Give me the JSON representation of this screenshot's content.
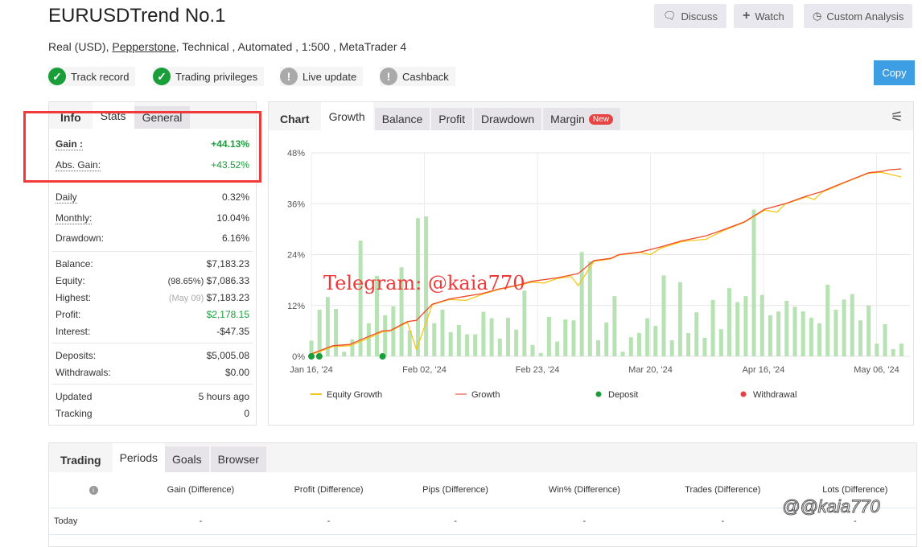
{
  "header": {
    "title": "EURUSDTrend No.1",
    "account_type": "Real (USD),",
    "broker": "Pepperstone",
    "details": ", Technical , Automated , 1:500 , MetaTrader 4",
    "buttons": {
      "discuss": "Discuss",
      "watch": "Watch",
      "custom_analysis": "Custom Analysis",
      "copy": "Copy"
    },
    "badges": [
      {
        "label": "Track record",
        "status": "verified"
      },
      {
        "label": "Trading privileges",
        "status": "verified"
      },
      {
        "label": "Live update",
        "status": "unverified"
      },
      {
        "label": "Cashback",
        "status": "unverified"
      }
    ]
  },
  "colors": {
    "green": "#1a9e3a",
    "accent": "#3d9ee4",
    "equity": "#f5c518",
    "growth": "#f04a2a",
    "bar": "#b7e2b3",
    "deposit": "#1a9e3a",
    "withdrawal": "#e84343"
  },
  "stats": {
    "tabs": [
      "Info",
      "Stats",
      "General"
    ],
    "gain": {
      "label": "Gain :",
      "value": "+44.13%"
    },
    "abs_gain": {
      "label": "Abs. Gain:",
      "value": "+43.52%"
    },
    "daily": {
      "label": "Daily",
      "value": "0.32%"
    },
    "monthly": {
      "label": "Monthly:",
      "value": "10.04%"
    },
    "drawdown": {
      "label": "Drawdown:",
      "value": "6.16%"
    },
    "balance": {
      "label": "Balance:",
      "value": "$7,183.23"
    },
    "equity": {
      "label": "Equity:",
      "note": "(98.65%)",
      "value": "$7,086.33"
    },
    "highest": {
      "label": "Highest:",
      "note": "(May 09)",
      "value": "$7,183.23"
    },
    "profit": {
      "label": "Profit:",
      "value": "$2,178.15"
    },
    "interest": {
      "label": "Interest:",
      "value": "-$47.35"
    },
    "deposits": {
      "label": "Deposits:",
      "value": "$5,005.08"
    },
    "withdrawals": {
      "label": "Withdrawals:",
      "value": "$0.00"
    },
    "updated": {
      "label": "Updated",
      "value": "5 hours ago"
    },
    "tracking": {
      "label": "Tracking",
      "value": "0"
    }
  },
  "chart_tabs": {
    "chart": "Chart",
    "growth": "Growth",
    "balance": "Balance",
    "profit": "Profit",
    "drawdown": "Drawdown",
    "margin": "Margin",
    "new_badge": "New"
  },
  "watermark": "Telegram: @kaia770",
  "watermark2": "@@kaia770",
  "chart_data": {
    "type": "line",
    "title": "Growth",
    "yticks": [
      "0%",
      "12%",
      "24%",
      "36%",
      "48%"
    ],
    "ylim": [
      0,
      48
    ],
    "xticks": [
      "Jan 16, '24",
      "Feb 02, '24",
      "Feb 23, '24",
      "Mar 20, '24",
      "Apr 16, '24",
      "May 06, '24"
    ],
    "legend": [
      "Equity Growth",
      "Growth",
      "Deposit",
      "Withdrawal"
    ],
    "legend_position": "bottom",
    "growth": [
      [
        0,
        0.6
      ],
      [
        0.19,
        2.5
      ],
      [
        0.34,
        2.8
      ],
      [
        0.48,
        4.4
      ],
      [
        0.63,
        6.0
      ],
      [
        0.7,
        6.1
      ],
      [
        0.85,
        8.2
      ],
      [
        0.93,
        8.5
      ],
      [
        1.07,
        12.3
      ],
      [
        1.22,
        13.5
      ],
      [
        1.37,
        14.2
      ],
      [
        1.51,
        14.8
      ],
      [
        1.66,
        15.9
      ],
      [
        1.81,
        16.7
      ],
      [
        1.95,
        17.7
      ],
      [
        2.17,
        18.5
      ],
      [
        2.36,
        19.5
      ],
      [
        2.5,
        22.6
      ],
      [
        2.65,
        23.1
      ],
      [
        2.72,
        24.0
      ],
      [
        2.91,
        24.6
      ],
      [
        3.09,
        25.8
      ],
      [
        3.27,
        27.2
      ],
      [
        3.49,
        28.4
      ],
      [
        3.64,
        29.8
      ],
      [
        3.83,
        31.7
      ],
      [
        4.01,
        34.7
      ],
      [
        4.19,
        36.0
      ],
      [
        4.38,
        37.8
      ],
      [
        4.52,
        38.9
      ],
      [
        4.6,
        39.8
      ],
      [
        4.74,
        41.3
      ],
      [
        4.93,
        43.3
      ],
      [
        5.04,
        43.6
      ],
      [
        5.11,
        44.0
      ],
      [
        5.22,
        44.2
      ]
    ],
    "equity_growth": [
      [
        0,
        0.4
      ],
      [
        0.19,
        2.3
      ],
      [
        0.34,
        2.5
      ],
      [
        0.48,
        4.0
      ],
      [
        0.63,
        5.8
      ],
      [
        0.7,
        6.0
      ],
      [
        0.85,
        8.0
      ],
      [
        0.93,
        1.6
      ],
      [
        1.07,
        12.2
      ],
      [
        1.22,
        13.4
      ],
      [
        1.37,
        13.2
      ],
      [
        1.51,
        14.6
      ],
      [
        1.66,
        15.8
      ],
      [
        1.81,
        16.6
      ],
      [
        1.95,
        17.5
      ],
      [
        2.06,
        17.3
      ],
      [
        2.17,
        18.3
      ],
      [
        2.3,
        18.8
      ],
      [
        2.36,
        16.7
      ],
      [
        2.5,
        22.4
      ],
      [
        2.65,
        23.0
      ],
      [
        2.72,
        23.9
      ],
      [
        2.91,
        24.5
      ],
      [
        3.0,
        24.0
      ],
      [
        3.09,
        25.5
      ],
      [
        3.27,
        27.0
      ],
      [
        3.35,
        27.3
      ],
      [
        3.49,
        27.6
      ],
      [
        3.64,
        29.6
      ],
      [
        3.83,
        31.6
      ],
      [
        4.01,
        34.5
      ],
      [
        4.12,
        34.0
      ],
      [
        4.19,
        35.9
      ],
      [
        4.38,
        37.6
      ],
      [
        4.45,
        37.0
      ],
      [
        4.52,
        38.8
      ],
      [
        4.6,
        39.6
      ],
      [
        4.74,
        41.2
      ],
      [
        4.93,
        43.2
      ],
      [
        5.04,
        43.4
      ],
      [
        5.11,
        43.0
      ],
      [
        5.22,
        42.3
      ]
    ],
    "daily_bars": [
      3.7,
      11,
      14,
      11.2,
      1.1,
      4,
      27.3,
      7.8,
      19,
      9.7,
      11.8,
      21,
      6.1,
      32.6,
      33,
      7.8,
      11,
      5.7,
      7.4,
      5.2,
      5.2,
      10.5,
      9,
      4.2,
      9.1,
      6.3,
      15.5,
      2.7,
      0.8,
      9.3,
      3.5,
      8.7,
      8.5,
      24.6,
      22.4,
      3.8,
      8,
      14.2,
      1.1,
      4.5,
      5.5,
      9,
      7.2,
      19.1,
      3.8,
      17.5,
      5.5,
      10.4,
      4.4,
      13.3,
      6.4,
      16.1,
      12.8,
      14.2,
      34.6,
      14.5,
      9.7,
      10.6,
      13.1,
      11.7,
      10.6,
      9.1,
      7.8,
      16.9,
      11,
      13.4,
      14.7,
      8.5,
      12,
      3,
      7.6,
      1.7,
      3
    ],
    "deposits": [
      0,
      0.07,
      0.63
    ]
  },
  "bottom": {
    "tabs": [
      "Trading",
      "Periods",
      "Goals",
      "Browser"
    ],
    "columns": [
      "Gain (Difference)",
      "Profit (Difference)",
      "Pips (Difference)",
      "Win% (Difference)",
      "Trades (Difference)",
      "Lots (Difference)"
    ],
    "rows": [
      {
        "label": "Today",
        "values": [
          "-",
          "-",
          "-",
          "-",
          "-",
          "-"
        ]
      }
    ]
  }
}
